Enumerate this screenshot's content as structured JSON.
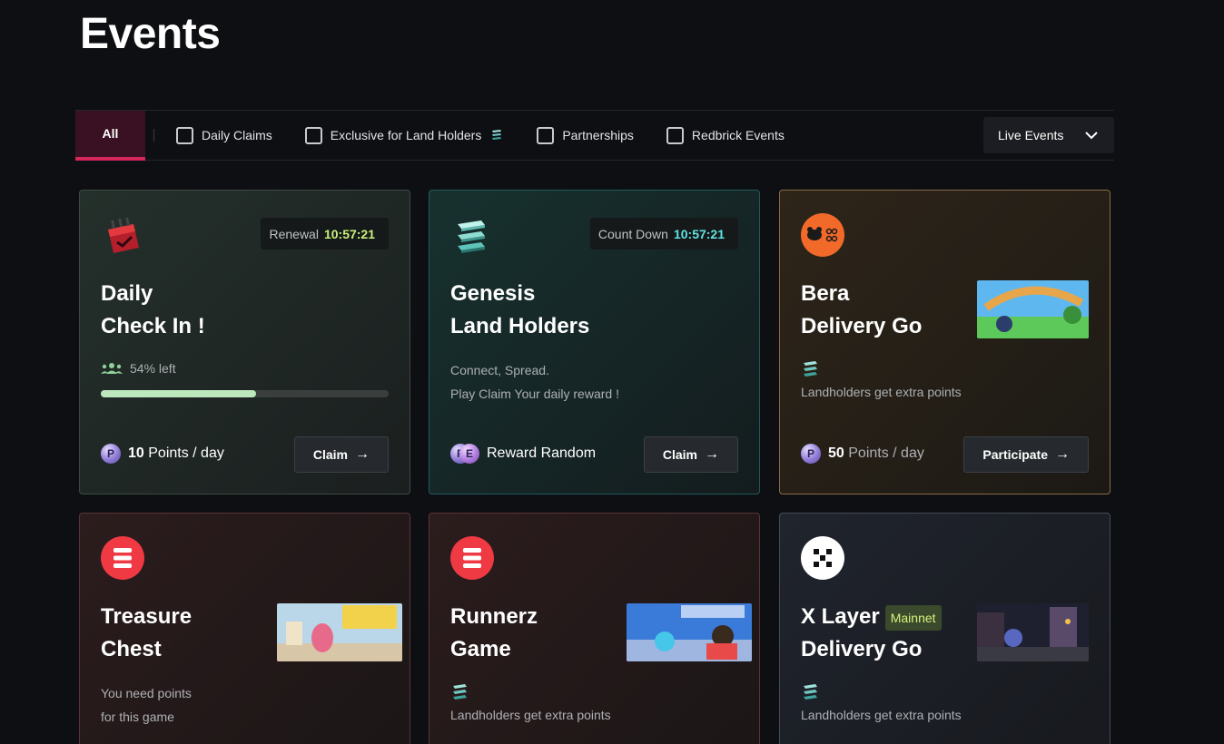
{
  "page": {
    "title": "Events"
  },
  "filters": {
    "all_label": "All",
    "options": [
      {
        "label": "Daily Claims",
        "checked": false
      },
      {
        "label": "Exclusive for Land Holders",
        "checked": false,
        "icon": "land-stack-icon"
      },
      {
        "label": "Partnerships",
        "checked": false
      },
      {
        "label": "Redbrick Events",
        "checked": false
      }
    ],
    "status_dropdown": {
      "selected": "Live Events",
      "icon": "chevron-down-icon"
    }
  },
  "cards": [
    {
      "id": "daily-check-in",
      "icon": "calendar-check-icon",
      "pill_label": "Renewal",
      "pill_time": "10:57:21",
      "title_line1": "Daily",
      "title_line2": "Check In !",
      "left_text": "54% left",
      "progress_fraction": 0.54,
      "points_value": "10",
      "points_unit": " Points / day",
      "button": "Claim"
    },
    {
      "id": "genesis-land-holders",
      "icon": "land-stack-icon",
      "pill_label": "Count Down",
      "pill_time": "10:57:21",
      "title_line1": "Genesis",
      "title_line2": "Land Holders",
      "desc_line1": "Connect, Spread.",
      "desc_line2": "Play Claim Your daily reward !",
      "reward_text": "Reward Random",
      "button": "Claim"
    },
    {
      "id": "bera-delivery-go",
      "icon": "bera-logo-icon",
      "title_line1": "Bera",
      "title_line2": "Delivery Go",
      "extra_text": "Landholders get extra points",
      "points_value": "50",
      "points_unit": " Points / day",
      "button": "Participate"
    },
    {
      "id": "treasure-chest",
      "icon": "redbrick-logo-icon",
      "title_line1": "Treasure",
      "title_line2": "Chest",
      "desc_line1": "You need points",
      "desc_line2": "for this game"
    },
    {
      "id": "runnerz-game",
      "icon": "redbrick-logo-icon",
      "title_line1": "Runnerz",
      "title_line2": "Game",
      "extra_text": "Landholders get extra points"
    },
    {
      "id": "x-layer-delivery-go",
      "icon": "x-layer-logo-icon",
      "title_line1": "X Layer",
      "badge": "Mainnet",
      "title_line2": "Delivery Go",
      "extra_text": "Landholders get extra points"
    }
  ],
  "colors": {
    "accent": "#d6265c",
    "timer_green": "#c9f07a",
    "timer_cyan": "#5fe3e3",
    "progress": "#bde8bd"
  }
}
